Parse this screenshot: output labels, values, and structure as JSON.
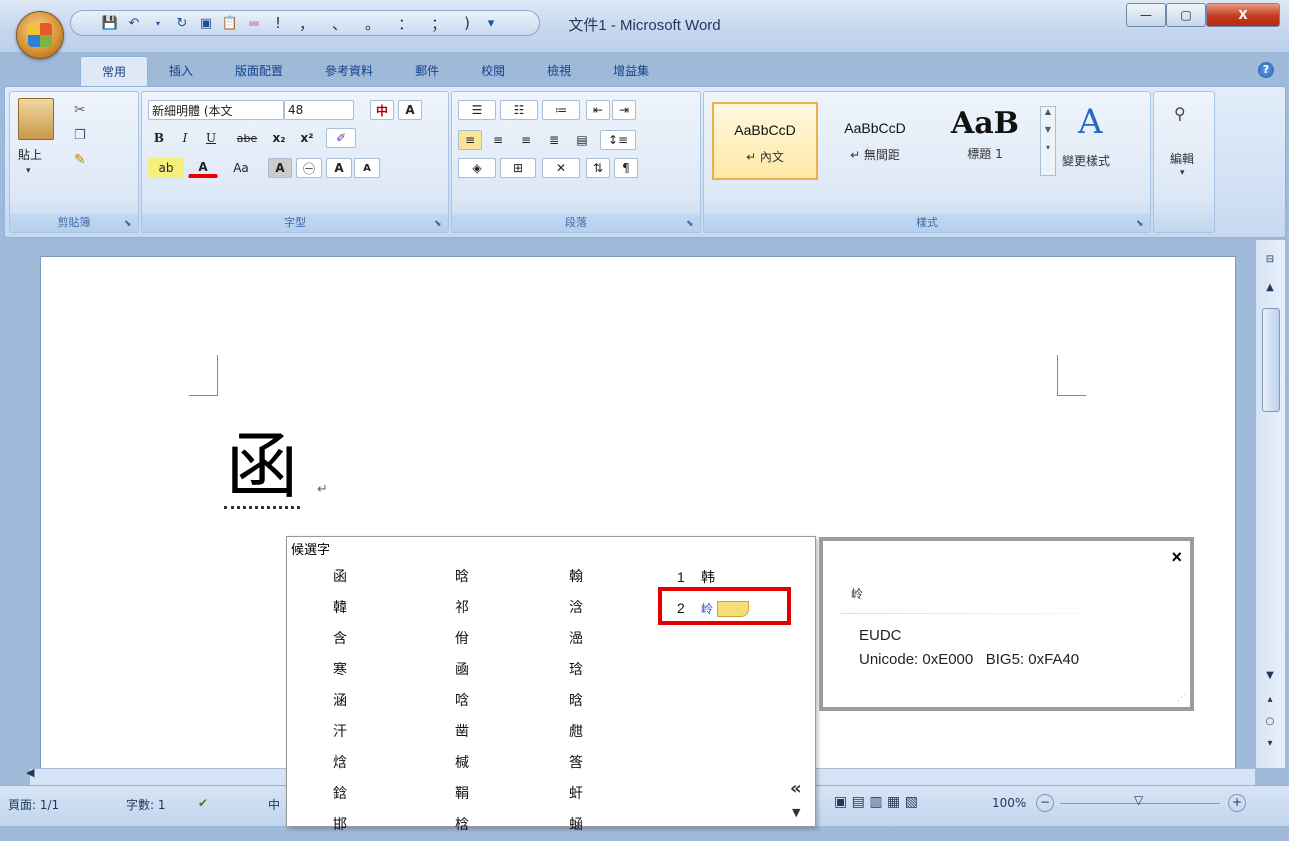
{
  "window": {
    "title": "文件1 - Microsoft Word",
    "min_label": "—",
    "max_label": "▢",
    "close_label": "X"
  },
  "qat": {
    "punct": [
      "!",
      "，",
      "、",
      "。",
      "：",
      "；",
      ")"
    ],
    "dropdown": "▾"
  },
  "tabs": [
    "常用",
    "插入",
    "版面配置",
    "參考資料",
    "郵件",
    "校閱",
    "檢視",
    "增益集"
  ],
  "active_tab": "常用",
  "ribbon": {
    "clipboard": {
      "label": "剪貼簿",
      "paste": "貼上"
    },
    "font": {
      "label": "字型",
      "font_name": "新細明體 (本文",
      "font_size": "48",
      "bold": "B",
      "italic": "I",
      "underline": "U",
      "strike": "abe",
      "sub": "x₂",
      "sup": "x²",
      "aa": "Aa",
      "grow": "A",
      "shrink": "A"
    },
    "paragraph": {
      "label": "段落"
    },
    "styles": {
      "label": "樣式",
      "cards": [
        {
          "sample": "AaBbCcD",
          "name": "↵ 內文"
        },
        {
          "sample": "AaBbCcD",
          "name": "↵ 無間距"
        },
        {
          "sample": "AaB",
          "name": "標題 1"
        }
      ],
      "change_styles": "變更樣式"
    },
    "editing": {
      "label": "編輯"
    }
  },
  "document": {
    "char": "函",
    "pilcrow": "↵"
  },
  "candidates": {
    "title": "候選字",
    "col1": [
      "函",
      "韓",
      "含",
      "寒",
      "涵",
      "汗",
      "焓",
      "鋡",
      "邯"
    ],
    "col2": [
      "晗",
      "祁",
      "佾",
      "凾",
      "唅",
      "凿",
      "椷",
      "鞙",
      "梒"
    ],
    "col3": [
      "翰",
      "浛",
      "澏",
      "琀",
      "晗",
      "甝",
      "筨",
      "虷",
      "蜬"
    ],
    "numbered": [
      {
        "num": "1",
        "char": "韩"
      },
      {
        "num": "2",
        "char": "岭"
      }
    ],
    "more": "«",
    "down": "▼"
  },
  "info": {
    "close": "×",
    "char": "岭",
    "eudc": "EUDC",
    "code": "Unicode: 0xE000   BIG5: 0xFA40"
  },
  "status": {
    "page": "頁面: 1/1",
    "words": "字數: 1",
    "lang": "中",
    "zoom": "100%",
    "zoom_out": "−",
    "zoom_in": "+"
  }
}
